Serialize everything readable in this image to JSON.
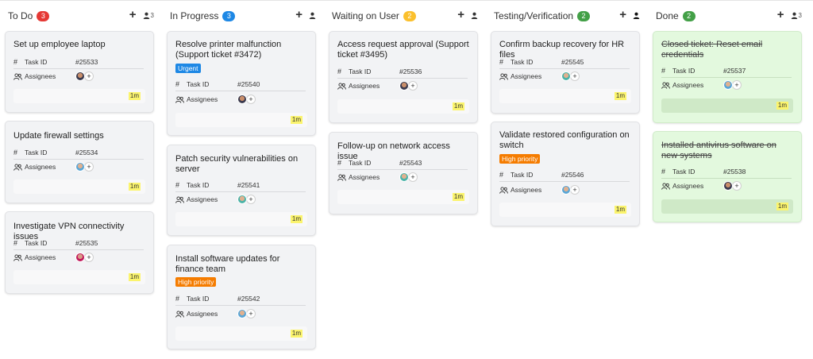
{
  "columns": [
    {
      "title": "To Do",
      "count": "3",
      "badge_color": "#e53935",
      "people_count": "3",
      "cards": [
        {
          "title": "Set up employee laptop",
          "task_id": "#25533"
        },
        {
          "title": "Update firewall settings",
          "task_id": "#25534"
        },
        {
          "title": "Investigate VPN connectivity issues",
          "task_id": "#25535"
        }
      ]
    },
    {
      "title": "In Progress",
      "count": "3",
      "badge_color": "#1e88e5",
      "people_count": "",
      "cards": [
        {
          "title": "Resolve printer malfunction (Support ticket #3472)",
          "tag": "Urgent",
          "task_id": "#25540"
        },
        {
          "title": "Patch security vulnerabilities on server",
          "task_id": "#25541"
        },
        {
          "title": "Install software updates for finance team",
          "tag": "High priority",
          "task_id": "#25542"
        }
      ]
    },
    {
      "title": "Waiting on User",
      "count": "2",
      "badge_color": "#fbc02d",
      "people_count": "",
      "cards": [
        {
          "title": "Access request approval (Support ticket #3495)",
          "task_id": "#25536"
        },
        {
          "title": "Follow-up on network access issue",
          "task_id": "#25543"
        }
      ]
    },
    {
      "title": "Testing/Verification",
      "count": "2",
      "badge_color": "#43a047",
      "people_count": "",
      "cards": [
        {
          "title": "Confirm backup recovery for HR files",
          "task_id": "#25545"
        },
        {
          "title": "Validate restored configuration on switch",
          "tag": "High priority",
          "task_id": "#25546"
        }
      ]
    },
    {
      "title": "Done",
      "count": "2",
      "badge_color": "#43a047",
      "people_count": "3",
      "cards": [
        {
          "title": "Closed ticket: Reset email credentials",
          "task_id": "#25537"
        },
        {
          "title": "Installed antivirus software on new systems",
          "task_id": "#25538"
        }
      ]
    }
  ],
  "labels": {
    "task_id": "Task ID",
    "assignees": "Assignees",
    "time": "1m"
  },
  "icons": {
    "add": "plus-icon",
    "people": "person-icon",
    "hash": "hash-icon",
    "assignees": "people-icon"
  },
  "colors": {
    "urgent": "#1e88e5",
    "high_priority": "#f57c00",
    "time_chip": "#fbf46d"
  }
}
